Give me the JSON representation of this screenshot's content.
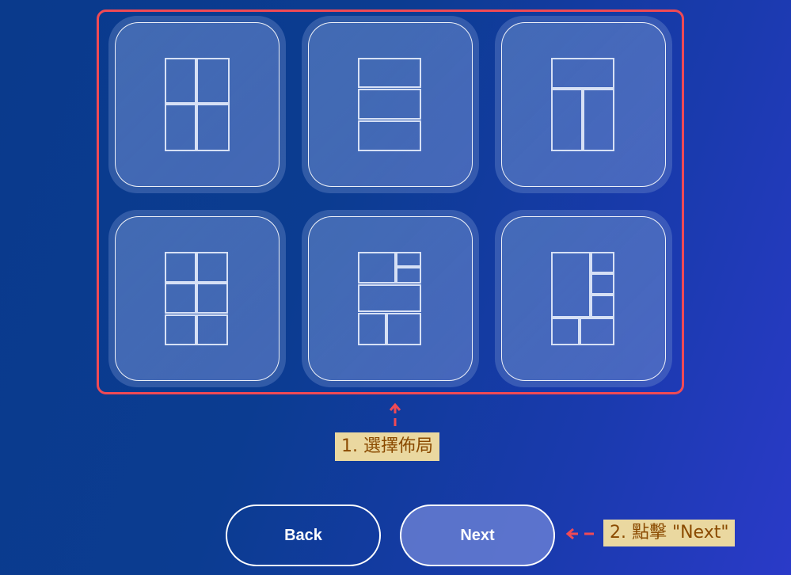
{
  "layout_picker": {
    "layouts": [
      {
        "id": "grid-2x2",
        "label": "2x2 grid"
      },
      {
        "id": "rows-3",
        "label": "3 rows"
      },
      {
        "id": "top-plus-2-columns",
        "label": "top row plus 2 columns"
      },
      {
        "id": "grid-2x3",
        "label": "2x3 grid"
      },
      {
        "id": "mixed-collage",
        "label": "mixed collage"
      },
      {
        "id": "big-left-collage",
        "label": "big left collage"
      }
    ]
  },
  "annotations": {
    "step1": "1. 選擇佈局",
    "step2": "2. 點擊 \"Next\""
  },
  "buttons": {
    "back": "Back",
    "next": "Next"
  },
  "colors": {
    "highlight": "#ef4a55",
    "caption_bg": "#ead8a0",
    "caption_text": "#8a4a00"
  }
}
